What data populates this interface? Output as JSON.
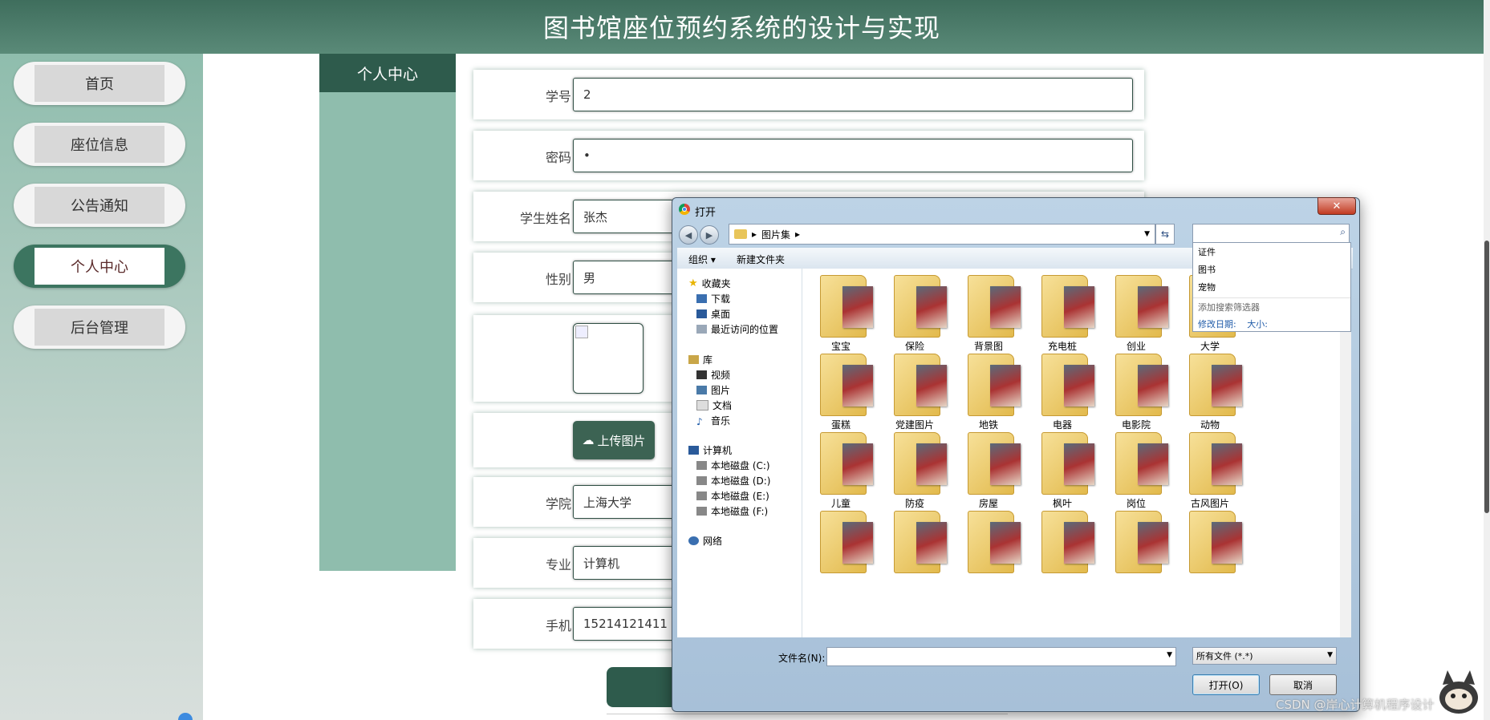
{
  "header": {
    "title": "图书馆座位预约系统的设计与实现"
  },
  "sidebar": {
    "items": [
      {
        "label": "首页",
        "active": false
      },
      {
        "label": "座位信息",
        "active": false
      },
      {
        "label": "公告通知",
        "active": false
      },
      {
        "label": "个人中心",
        "active": true
      },
      {
        "label": "后台管理",
        "active": false
      }
    ]
  },
  "panel": {
    "title": "个人中心"
  },
  "form": {
    "student_id": {
      "label": "学号",
      "value": "2"
    },
    "password": {
      "label": "密码",
      "value": "•"
    },
    "student_name": {
      "label": "学生姓名",
      "value": "张杰"
    },
    "gender": {
      "label": "性别",
      "value": "男"
    },
    "upload_button": "上传图片",
    "college": {
      "label": "学院",
      "value": "上海大学"
    },
    "major": {
      "label": "专业",
      "value": "计算机"
    },
    "phone": {
      "label": "手机",
      "value": "15214121411"
    }
  },
  "dialog": {
    "title": "打开",
    "close": "✕",
    "breadcrumb": "图片集",
    "toolbar": {
      "organize": "组织 ▾",
      "new_folder": "新建文件夹"
    },
    "search_suggestions": [
      "证件",
      "图书",
      "宠物"
    ],
    "search_hint": "添加搜索筛选器",
    "search_filters": {
      "date": "修改日期:",
      "size": "大小:"
    },
    "nav": {
      "favorites": "收藏夹",
      "downloads": "下载",
      "desktop": "桌面",
      "recent": "最近访问的位置",
      "libraries": "库",
      "videos": "视频",
      "pictures": "图片",
      "documents": "文档",
      "music": "音乐",
      "computer": "计算机",
      "disk_c": "本地磁盘 (C:)",
      "disk_d": "本地磁盘 (D:)",
      "disk_e": "本地磁盘 (E:)",
      "disk_f": "本地磁盘 (F:)",
      "network": "网络"
    },
    "folders": [
      "宝宝",
      "保险",
      "背景图",
      "充电桩",
      "创业",
      "大学",
      "蛋糕",
      "党建图片",
      "地铁",
      "电器",
      "电影院",
      "动物",
      "儿童",
      "防疫",
      "房屋",
      "枫叶",
      "岗位",
      "古风图片"
    ],
    "filename_label": "文件名(N):",
    "filename_value": "",
    "filetype": "所有文件 (*.*)",
    "open_button": "打开(O)",
    "cancel_button": "取消"
  },
  "watermark": "CSDN @岸心计算机程序设计",
  "colors": {
    "header": "#3f6e5d",
    "active_nav": "#3c7560",
    "panel": "#8fbdad",
    "button": "#3c6353"
  }
}
